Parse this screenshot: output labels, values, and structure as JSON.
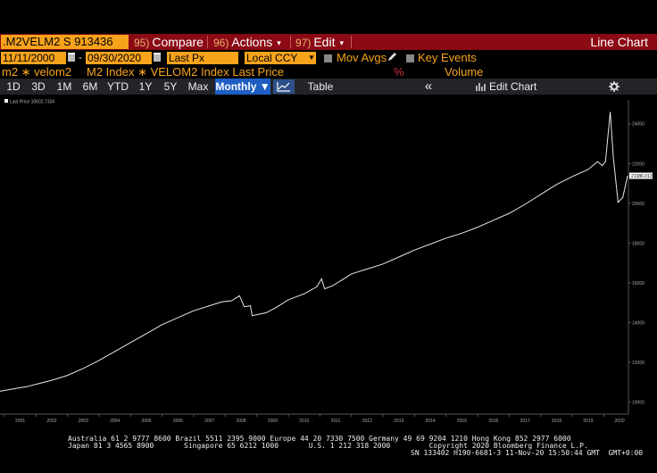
{
  "header": {
    "ticker": ".M2VELM2 S 913436",
    "menus": [
      {
        "num": "95)",
        "label": "Compare",
        "caret": ""
      },
      {
        "num": "96)",
        "label": "Actions",
        "caret": "▾"
      },
      {
        "num": "97)",
        "label": "Edit",
        "caret": "▾"
      }
    ],
    "chart_type_label": "Line Chart"
  },
  "controls": {
    "start_date": "11/11/2000",
    "end_date": "09/30/2020",
    "date_separator": "-",
    "price_field": "Last Px",
    "currency": "Local CCY",
    "mov_avgs_label": "Mov Avgs",
    "key_events_label": "Key Events"
  },
  "formula": {
    "name": "m2 ∗ velom2",
    "expression": "M2 Index ∗ VELOM2 Index Last Price",
    "percent_label": "%",
    "volume_label": "Volume"
  },
  "ranges": {
    "items": [
      "1D",
      "3D",
      "1M",
      "6M",
      "YTD",
      "1Y",
      "5Y",
      "Max"
    ],
    "frequency": "Monthly ▼",
    "table_label": "Table",
    "collapse_glyph": "«",
    "edit_chart_label": "Edit Chart"
  },
  "chart_data": {
    "type": "line",
    "legend": "Last Price 10502.7334",
    "last_value_label": "21386.0137",
    "x_ticks": [
      "2001",
      "2002",
      "2003",
      "2004",
      "2005",
      "2006",
      "2007",
      "2008",
      "2009",
      "2010",
      "2011",
      "2012",
      "2013",
      "2014",
      "2015",
      "2016",
      "2017",
      "2018",
      "2019",
      "2020"
    ],
    "y_ticks": [
      10000,
      12000,
      14000,
      16000,
      18000,
      20000,
      22000,
      24000
    ],
    "xlim": [
      2000.86,
      2020.75
    ],
    "ylim": [
      9400,
      25200
    ],
    "grid": false,
    "series": [
      {
        "x": [
          2000.86,
          2001.2,
          2001.7,
          2002.0,
          2002.5,
          2003.0,
          2003.5,
          2004.0,
          2004.5,
          2005.0,
          2005.5,
          2006.0,
          2006.5,
          2007.0,
          2007.5,
          2007.9,
          2008.2,
          2008.45,
          2008.6,
          2008.8,
          2008.85,
          2009.0,
          2009.3,
          2009.6,
          2010.0,
          2010.5,
          2010.9,
          2011.05,
          2011.15,
          2011.4,
          2011.8,
          2012.0,
          2012.5,
          2013.0,
          2013.5,
          2014.0,
          2014.5,
          2015.0,
          2015.5,
          2016.0,
          2016.5,
          2017.0,
          2017.5,
          2018.0,
          2018.5,
          2019.0,
          2019.5,
          2019.8,
          2019.95,
          2020.05,
          2020.2,
          2020.3,
          2020.45,
          2020.6,
          2020.75
        ],
        "y": [
          10550,
          10650,
          10780,
          10900,
          11100,
          11350,
          11700,
          12100,
          12550,
          13000,
          13450,
          13900,
          14250,
          14600,
          14850,
          15050,
          15100,
          15350,
          14800,
          14850,
          14350,
          14400,
          14500,
          14750,
          15150,
          15450,
          15800,
          16200,
          15700,
          15850,
          16250,
          16450,
          16700,
          16950,
          17300,
          17650,
          17950,
          18250,
          18500,
          18800,
          19150,
          19500,
          19950,
          20450,
          20950,
          21350,
          21700,
          22100,
          21900,
          22100,
          24600,
          22300,
          20050,
          20300,
          21386
        ]
      }
    ]
  },
  "footer": {
    "line1": "Australia 61 2 9777 8600 Brazil 5511 2395 9000 Europe 44 20 7330 7500 Germany 49 69 9204 1210 Hong Kong 852 2977 6000",
    "line2": "Japan 81 3 4565 8900       Singapore 65 6212 1000       U.S. 1 212 318 2000         Copyright 2020 Bloomberg Finance L.P.",
    "line3": "SN 133402 H190-6681-3 11-Nov-20 15:50:44 GMT  GMT+0:00"
  },
  "colors": {
    "accent_orange": "#f7a31c",
    "menu_bar_red": "#8b0a14",
    "line_color": "#e8e8e8",
    "axis_text": "#aaaaaa",
    "highlight_blue": "#1f5fc4"
  }
}
